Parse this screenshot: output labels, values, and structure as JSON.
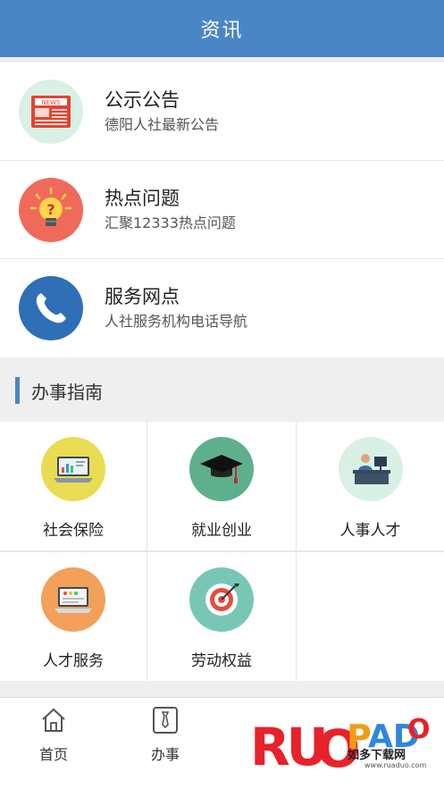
{
  "header": {
    "title": "资讯"
  },
  "news": [
    {
      "title": "公示公告",
      "subtitle": "德阳人社最新公告",
      "icon": "news-icon",
      "bg": "#d9f0e4"
    },
    {
      "title": "热点问题",
      "subtitle": "汇聚12333热点问题",
      "icon": "lightbulb-icon",
      "bg": "#f06a5c"
    },
    {
      "title": "服务网点",
      "subtitle": "人社服务机构电话导航",
      "icon": "phone-icon",
      "bg": "#2e6fb6"
    }
  ],
  "guide": {
    "title": "办事指南",
    "items": [
      {
        "label": "社会保险",
        "icon": "laptop-chart-icon",
        "bg": "#e9dc52"
      },
      {
        "label": "就业创业",
        "icon": "graduation-cap-icon",
        "bg": "#5db08b"
      },
      {
        "label": "人事人才",
        "icon": "office-worker-icon",
        "bg": "#d9f0e4"
      },
      {
        "label": "人才服务",
        "icon": "laptop-icon",
        "bg": "#f2a05a"
      },
      {
        "label": "劳动权益",
        "icon": "target-icon",
        "bg": "#78c7b5"
      }
    ]
  },
  "tabbar": {
    "items": [
      {
        "label": "首页",
        "icon": "home-icon"
      },
      {
        "label": "办事",
        "icon": "tie-icon"
      }
    ]
  },
  "watermark": {
    "brand": "RUOPAD",
    "text": "如多下载网",
    "url": "www.ruaduo.com"
  },
  "colors": {
    "accent": "#4a86c5"
  }
}
